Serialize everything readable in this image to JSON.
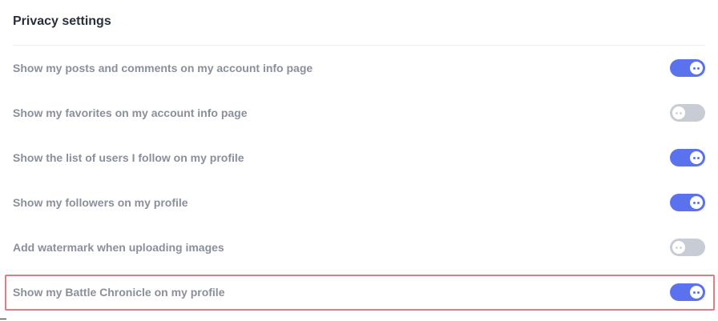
{
  "title": "Privacy settings",
  "settings": [
    {
      "label": "Show my posts and comments on my account info page",
      "enabled": true
    },
    {
      "label": "Show my favorites on my account info page",
      "enabled": false
    },
    {
      "label": "Show the list of users I follow on my profile",
      "enabled": true
    },
    {
      "label": "Show my followers on my profile",
      "enabled": true
    },
    {
      "label": "Add watermark when uploading images",
      "enabled": false
    },
    {
      "label": "Show my Battle Chronicle on my profile",
      "enabled": true
    }
  ],
  "colors": {
    "toggle_on": "#5b72ee",
    "toggle_off": "#c7ccd5",
    "highlight": "#e07a85"
  }
}
